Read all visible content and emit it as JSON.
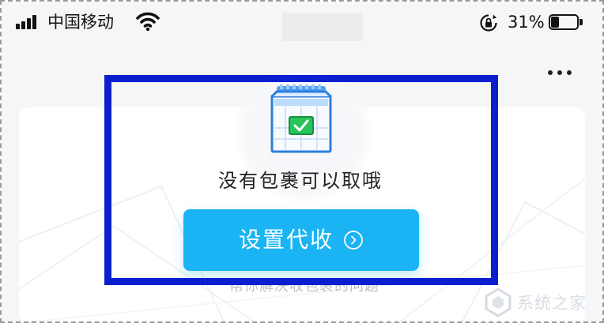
{
  "status_bar": {
    "carrier": "中国移动",
    "battery_percent": "31%",
    "battery_level": 0.31,
    "signal_icon": "signal-bars-icon",
    "wifi_icon": "wifi-icon",
    "lock_icon": "rotation-lock-icon"
  },
  "header": {
    "more_icon": "more-dots-icon"
  },
  "card": {
    "illustration_icon": "parcel-box-icon",
    "empty_message": "没有包裹可以取哦",
    "button_label": "设置代收",
    "button_icon": "arrow-circle-icon",
    "hint": "帮你解决收包裹的问题"
  },
  "watermark": {
    "text": "系统之家"
  },
  "colors": {
    "accent": "#1ab4f4",
    "highlight_border": "#0b1fce",
    "check_green": "#27c45c"
  }
}
